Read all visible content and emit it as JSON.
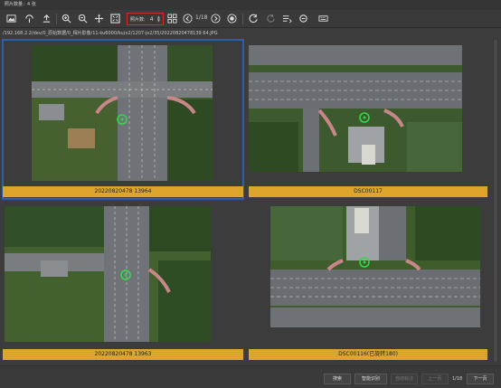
{
  "window": {
    "title": "照片数量：4 张"
  },
  "toolbar": {
    "count_label": "照片数:",
    "count_value": "4",
    "page_indicator": "1/18"
  },
  "path": "/192.168.2.2/dev/0_原始数据/0_相片影像/11-ku6000/ku(x2/1207-jx2/35/20220820478139 64.JPG",
  "images": [
    {
      "caption": "20220820478 13964",
      "selected": true
    },
    {
      "caption": "DSC00117",
      "selected": false
    },
    {
      "caption": "20220820478 13963",
      "selected": false
    },
    {
      "caption": "DSC00116(已旋转180)",
      "selected": false
    }
  ],
  "footer": {
    "search_label": "搜索",
    "smart_label": "智能识别",
    "third_label": "自动标注",
    "prev_label": "上一页",
    "page_label": "1/18",
    "next_label": "下一页"
  }
}
